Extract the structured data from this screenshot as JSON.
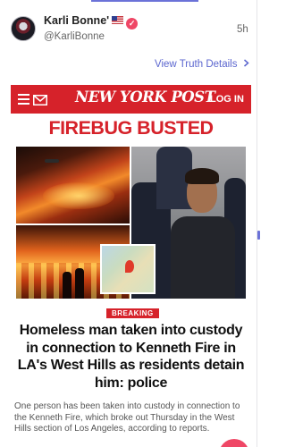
{
  "post": {
    "author_name": "Karli Bonne'",
    "handle": "@KarliBonne",
    "timestamp": "5h",
    "view_details": "View Truth Details",
    "icons": [
      "avatar",
      "us-flag-icon",
      "verified-badge-icon",
      "chevron-right-icon"
    ]
  },
  "news_card": {
    "brand": "NEW YORK POST",
    "login_label": "LOG IN",
    "banner_headline": "FIREBUG BUSTED",
    "tag": "BREAKING",
    "title": "Homeless man taken into custody in connection to Kenneth Fire in LA's West Hills as residents detain him: police",
    "description": "One person has been taken into custody in connection to the Kenneth Fire, which broke out Thursday in the West Hills section of Los Angeles, according to reports.",
    "icons": [
      "menu-icon",
      "mail-icon"
    ]
  },
  "colors": {
    "accent": "#6b72d8",
    "link": "#5b66cf",
    "verified": "#ef4766",
    "nyp_red": "#d6222a"
  }
}
